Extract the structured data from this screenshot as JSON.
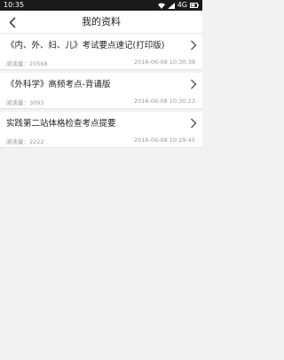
{
  "status_bar": {
    "time": "10:35",
    "network": "4G"
  },
  "nav": {
    "title": "我的资料"
  },
  "items": [
    {
      "title": "《内、外、妇、儿》考试要点速记(打印版)",
      "views": "阅读量：20568",
      "time": "2016-06-08 10:30:38"
    },
    {
      "title": "《外科学》高频考点-背诵版",
      "views": "阅读量：3093",
      "time": "2016-06-08 10:30:23"
    },
    {
      "title": "实践第二站体格检查考点提要",
      "views": "阅读量：2222",
      "time": "2016-06-08 10:29:45"
    }
  ],
  "colors": {
    "status_bg": "#1a1a1a",
    "page_bg": "#f2f2f2",
    "card_bg": "#ffffff",
    "meta_text": "#9a9a9a"
  }
}
